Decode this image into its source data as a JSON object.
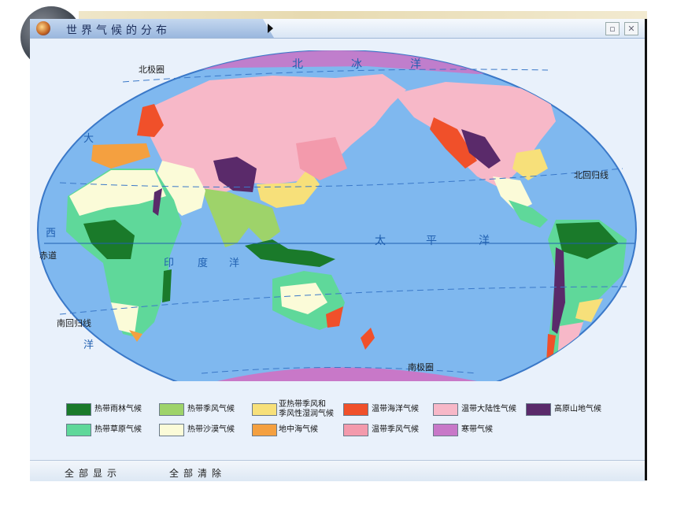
{
  "window": {
    "title": "世界气候的分布"
  },
  "controls": {
    "minimize": "▫",
    "close": "✕"
  },
  "map_labels": {
    "north_polar_circle": "北极圈",
    "arctic_ocean": [
      "北",
      "冰",
      "洋"
    ],
    "atlantic_left": [
      "大",
      "西",
      "洋"
    ],
    "indian_ocean": [
      "印",
      "度",
      "洋"
    ],
    "pacific_ocean": [
      "太",
      "平",
      "洋"
    ],
    "equator": "赤道",
    "tropic_cancer": "北回归线",
    "tropic_capricorn": "南回归线",
    "south_polar_circle": "南极圈"
  },
  "legend": [
    {
      "label": "热带雨林气候",
      "color": "#1a7a2a"
    },
    {
      "label": "热带季风气候",
      "color": "#9ed36a"
    },
    {
      "label": [
        "亚热带季风和",
        "季风性湿润气候"
      ],
      "color": "#f7e07a"
    },
    {
      "label": "温带海洋气候",
      "color": "#f0502a"
    },
    {
      "label": "温带大陆性气候",
      "color": "#f7b8c8"
    },
    {
      "label": "高原山地气候",
      "color": "#5a2a6a"
    },
    {
      "label": "热带草原气候",
      "color": "#5fd89a"
    },
    {
      "label": "热带沙漠气候",
      "color": "#fbfbd8"
    },
    {
      "label": "地中海气候",
      "color": "#f4a040"
    },
    {
      "label": "温带季风气候",
      "color": "#f39aac"
    },
    {
      "label": "寒带气候",
      "color": "#c878c8"
    }
  ],
  "bottom": {
    "show_all": "全部显示",
    "clear_all": "全部清除"
  },
  "colors": {
    "ocean": "#7fb8ef",
    "map_bg": "#e9f1fb",
    "border": "#3a78c8"
  }
}
